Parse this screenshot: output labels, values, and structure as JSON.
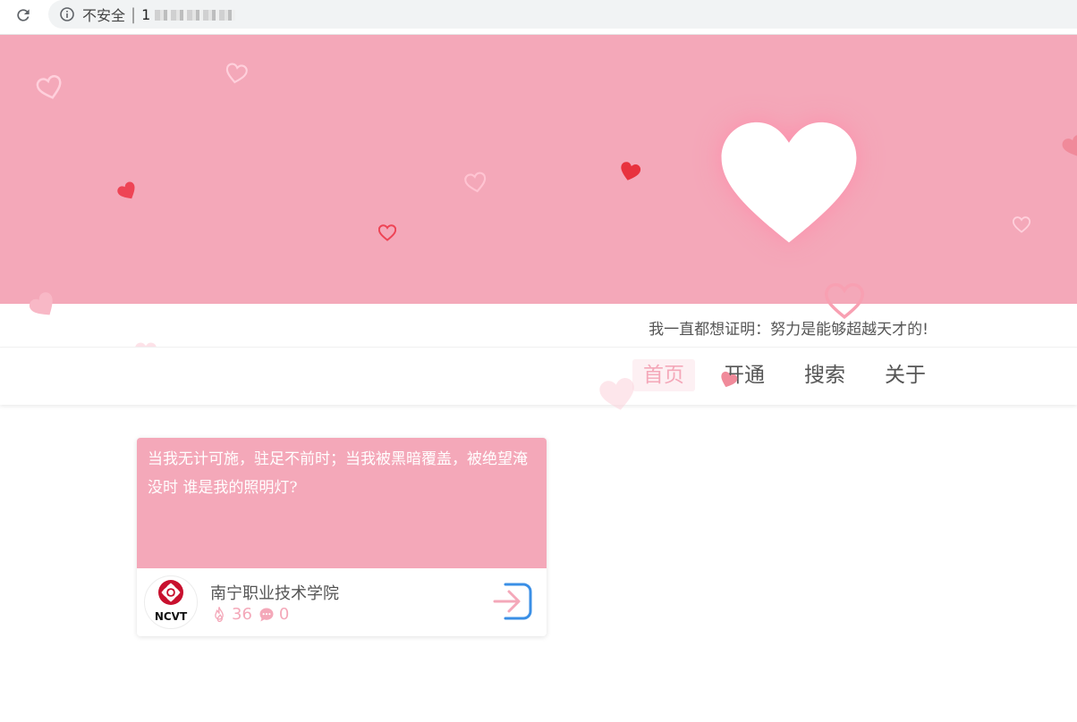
{
  "browser": {
    "security_label": "不安全",
    "separator": "|",
    "url_visible_prefix": "1"
  },
  "slogan": "我一直都想证明：努力是能够超越天才的!",
  "nav": {
    "items": [
      {
        "label": "首页",
        "active": true
      },
      {
        "label": "开通",
        "active": false
      },
      {
        "label": "搜索",
        "active": false
      },
      {
        "label": "关于",
        "active": false
      }
    ]
  },
  "card": {
    "text": "当我无计可施，驻足不前时；当我被黑暗覆盖，被绝望淹没时 谁是我的照明灯?",
    "school_name": "南宁职业技术学院",
    "hot_count": "36",
    "comment_count": "0"
  },
  "logo_text": "NCVT",
  "icons": [
    "reload-icon",
    "info-icon",
    "heart-icon",
    "flame-icon",
    "comment-icon",
    "enter-icon"
  ],
  "colors": {
    "brand_pink": "#f4a8b9",
    "enter_blue": "#3a8fe6",
    "heart_red": "#ee4455"
  }
}
